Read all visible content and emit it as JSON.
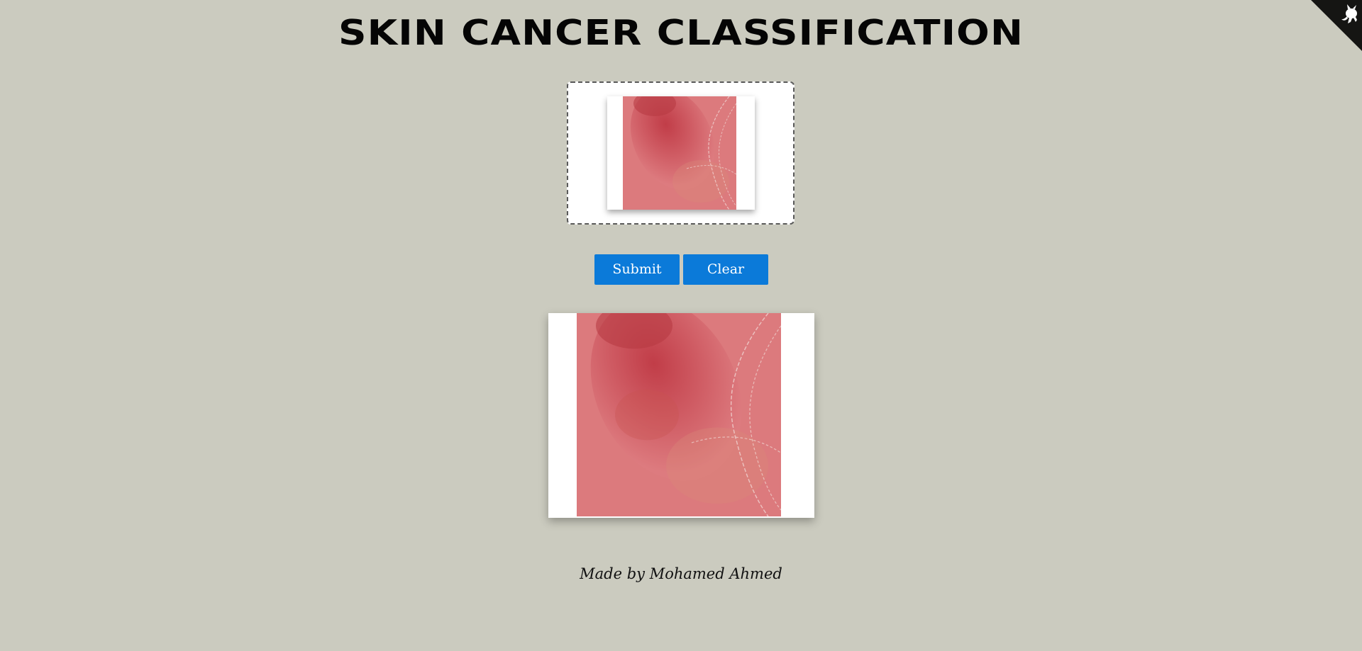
{
  "header": {
    "title": "SKIN CANCER CLASSIFICATION"
  },
  "corner": {
    "icon": "github-octocat-icon",
    "color": "#151513"
  },
  "upload": {
    "thumbnail_icon": "skin-lesion-image"
  },
  "actions": {
    "submit_label": "Submit",
    "clear_label": "Clear",
    "button_color": "#0b7ad9"
  },
  "preview": {
    "image_icon": "skin-lesion-image"
  },
  "footer": {
    "credit": "Made by Mohamed Ahmed"
  },
  "theme": {
    "background": "#cbcbbf"
  }
}
